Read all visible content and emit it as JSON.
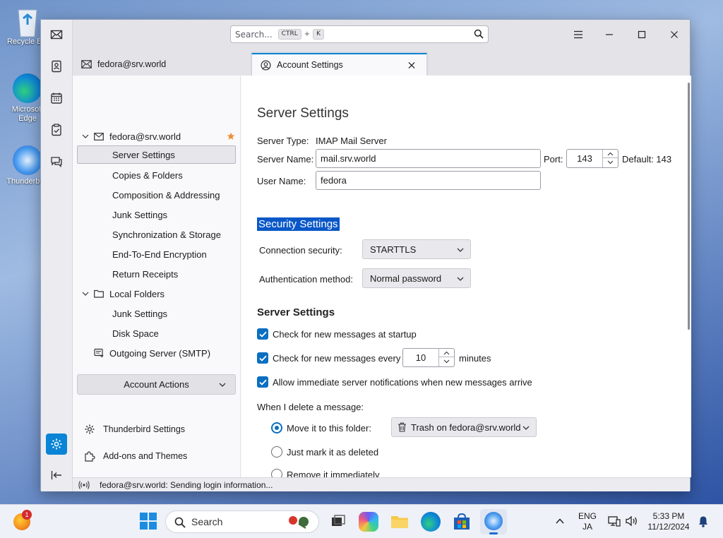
{
  "desktop": {
    "icons": [
      {
        "label": "Recycle Bin",
        "icon": "recycle-bin-icon"
      },
      {
        "label": "Microsoft Edge",
        "icon": "edge-icon"
      },
      {
        "label": "Thunderbird",
        "icon": "thunderbird-icon"
      }
    ]
  },
  "titlebar": {
    "search_placeholder": "Search...",
    "shortcut_key1": "CTRL",
    "shortcut_plus": "+",
    "shortcut_key2": "K"
  },
  "tabs": [
    {
      "label": "fedora@srv.world",
      "icon": "mail-icon"
    },
    {
      "label": "Account Settings",
      "icon": "account-settings-icon"
    }
  ],
  "tree": {
    "account": "fedora@srv.world",
    "account_items": [
      "Server Settings",
      "Copies & Folders",
      "Composition & Addressing",
      "Junk Settings",
      "Synchronization & Storage",
      "End-To-End Encryption",
      "Return Receipts"
    ],
    "local_folders": "Local Folders",
    "local_items": [
      "Junk Settings",
      "Disk Space"
    ],
    "outgoing": "Outgoing Server (SMTP)",
    "account_actions": "Account Actions",
    "thunderbird_settings": "Thunderbird Settings",
    "addons": "Add-ons and Themes"
  },
  "content": {
    "title": "Server Settings",
    "server_type_label": "Server Type:",
    "server_type_value": "IMAP Mail Server",
    "server_name_label": "Server Name:",
    "server_name_value": "mail.srv.world",
    "port_label": "Port:",
    "port_value": "143",
    "default_label": "Default: 143",
    "user_name_label": "User Name:",
    "user_name_value": "fedora",
    "security_heading": "Security Settings",
    "connection_security_label": "Connection security:",
    "connection_security_value": "STARTTLS",
    "auth_method_label": "Authentication method:",
    "auth_method_value": "Normal password",
    "server_settings_heading": "Server Settings",
    "check_startup": "Check for new messages at startup",
    "check_every_prefix": "Check for new messages every",
    "check_every_value": "10",
    "check_every_suffix": "minutes",
    "allow_notifications": "Allow immediate server notifications when new messages arrive",
    "delete_label": "When I delete a message:",
    "move_option": "Move it to this folder:",
    "trash_folder": "Trash on fedora@srv.world",
    "mark_option": "Just mark it as deleted",
    "remove_option": "Remove it immediately"
  },
  "status": {
    "text": "fedora@srv.world: Sending login information..."
  },
  "taskbar": {
    "search_placeholder": "Search",
    "notification_count": "1",
    "lang1": "ENG",
    "lang2": "JA",
    "time": "5:33 PM",
    "date": "11/12/2024"
  },
  "colors": {
    "accent": "#0a84d6",
    "selection": "#0a58c8",
    "checkbox": "#0a6fc2"
  }
}
